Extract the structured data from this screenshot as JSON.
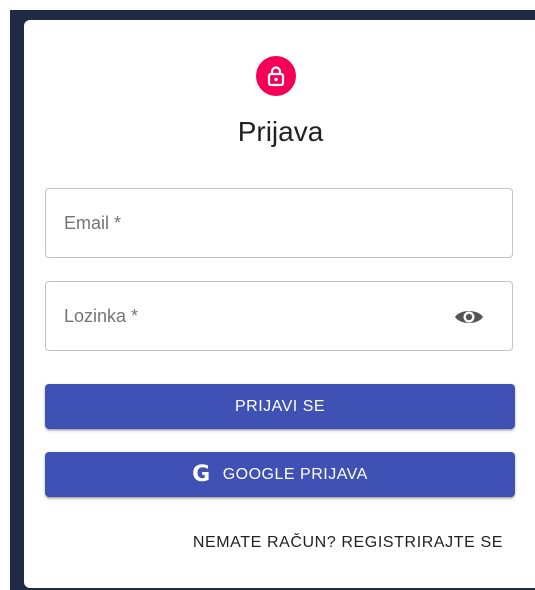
{
  "title": "Prijava",
  "form": {
    "email_placeholder": "Email *",
    "password_placeholder": "Lozinka *"
  },
  "buttons": {
    "login_label": "PRIJAVI SE",
    "google_label": "GOOGLE PRIJAVA",
    "google_icon_text": "G"
  },
  "links": {
    "register_label": "NEMATE RAČUN? REGISTRIRAJTE SE"
  },
  "icons": {
    "avatar": "lock-icon",
    "password_toggle": "eye-icon"
  },
  "colors": {
    "backdrop": "#1f2a44",
    "avatar_bg": "#f50057",
    "primary": "#3f51b5",
    "border": "#c4c4c4",
    "placeholder_text": "#757575"
  }
}
